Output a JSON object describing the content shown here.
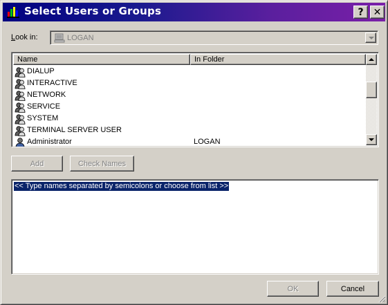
{
  "window": {
    "title": "Select Users or Groups",
    "help_label": "?",
    "close_label": "✕"
  },
  "lookin": {
    "label_prefix": "",
    "label_accel": "L",
    "label_rest": "ook in:",
    "value": "LOGAN"
  },
  "list": {
    "columns": [
      "Name",
      "In Folder"
    ],
    "rows": [
      {
        "name": "DIALUP",
        "folder": "",
        "icon": "group-icon"
      },
      {
        "name": "INTERACTIVE",
        "folder": "",
        "icon": "group-icon"
      },
      {
        "name": "NETWORK",
        "folder": "",
        "icon": "group-icon"
      },
      {
        "name": "SERVICE",
        "folder": "",
        "icon": "group-icon"
      },
      {
        "name": "SYSTEM",
        "folder": "",
        "icon": "group-icon"
      },
      {
        "name": "TERMINAL SERVER USER",
        "folder": "",
        "icon": "group-icon"
      },
      {
        "name": "Administrator",
        "folder": "LOGAN",
        "icon": "user-icon"
      }
    ]
  },
  "buttons": {
    "add": "Add",
    "check_names": "Check Names",
    "ok": "OK",
    "cancel": "Cancel"
  },
  "names": {
    "hint": "<< Type names separated by semicolons or choose from list >>"
  },
  "colors": {
    "titlebar_start": "#000080",
    "titlebar_end": "#7a1fa8",
    "selection": "#0a246a",
    "face": "#d4d0c8"
  }
}
